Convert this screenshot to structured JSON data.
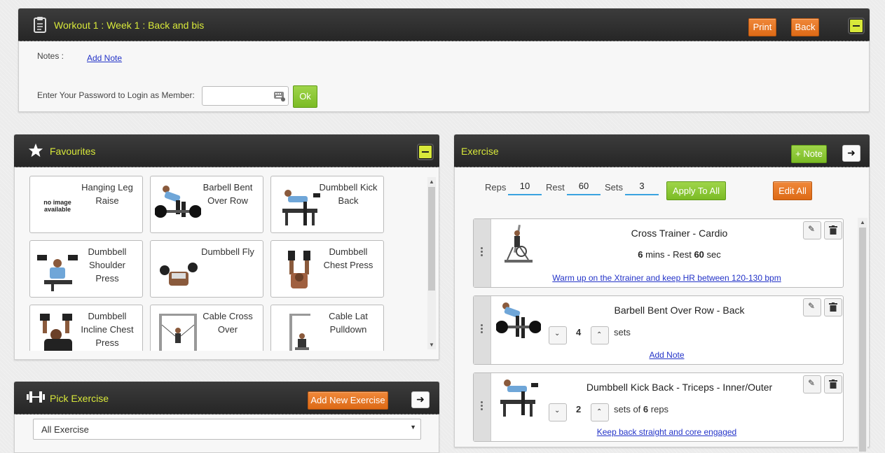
{
  "workout": {
    "title": "Workout 1 : Week 1 : Back and bis",
    "print_label": "Print",
    "back_label": "Back",
    "notes_label": "Notes :",
    "add_note_link": "Add Note",
    "password_label": "Enter Your Password to Login as Member:",
    "password_value": "",
    "ok_label": "Ok"
  },
  "favourites": {
    "title": "Favourites",
    "items": [
      {
        "label": "Hanging Leg Raise",
        "image": "no image available"
      },
      {
        "label": "Barbell Bent Over Row"
      },
      {
        "label": "Dumbbell Kick Back"
      },
      {
        "label": "Dumbbell Shoulder Press"
      },
      {
        "label": "Dumbbell Fly"
      },
      {
        "label": "Dumbbell Chest Press"
      },
      {
        "label": "Dumbbell Incline Chest Press"
      },
      {
        "label": "Cable Cross Over"
      },
      {
        "label": "Cable Lat Pulldown"
      }
    ]
  },
  "pick_exercise": {
    "title": "Pick Exercise",
    "add_new_label": "Add New Exercise",
    "select_value": "All Exercise"
  },
  "exercise": {
    "title": "Exercise",
    "note_button": "+ Note",
    "reps_label": "Reps",
    "reps_value": "10",
    "rest_label": "Rest",
    "rest_value": "60",
    "sets_label": "Sets",
    "sets_value": "3",
    "apply_all_label": "Apply To All",
    "edit_all_label": "Edit All",
    "items": [
      {
        "title": "Cross Trainer - Cardio",
        "detail_num1": "6",
        "detail_text1": " mins - Rest ",
        "detail_num2": "60",
        "detail_text2": " sec",
        "note": "Warm up on the Xtrainer and keep HR between 120-130 bpm"
      },
      {
        "title": "Barbell Bent Over Row - Back",
        "count": "4",
        "count_text": "sets",
        "note": "Add Note"
      },
      {
        "title": "Dumbbell Kick Back - Triceps - Inner/Outer",
        "count": "2",
        "count_text_pre": "sets of ",
        "count_reps": "6",
        "count_text_post": " reps",
        "note": "Keep back straight and core engaged"
      }
    ]
  },
  "colors": {
    "header_bg": "#2e2e2e",
    "title_accent": "#d8e83a",
    "orange": "#e8761f",
    "green": "#8cc63f",
    "link": "#2333c8"
  }
}
